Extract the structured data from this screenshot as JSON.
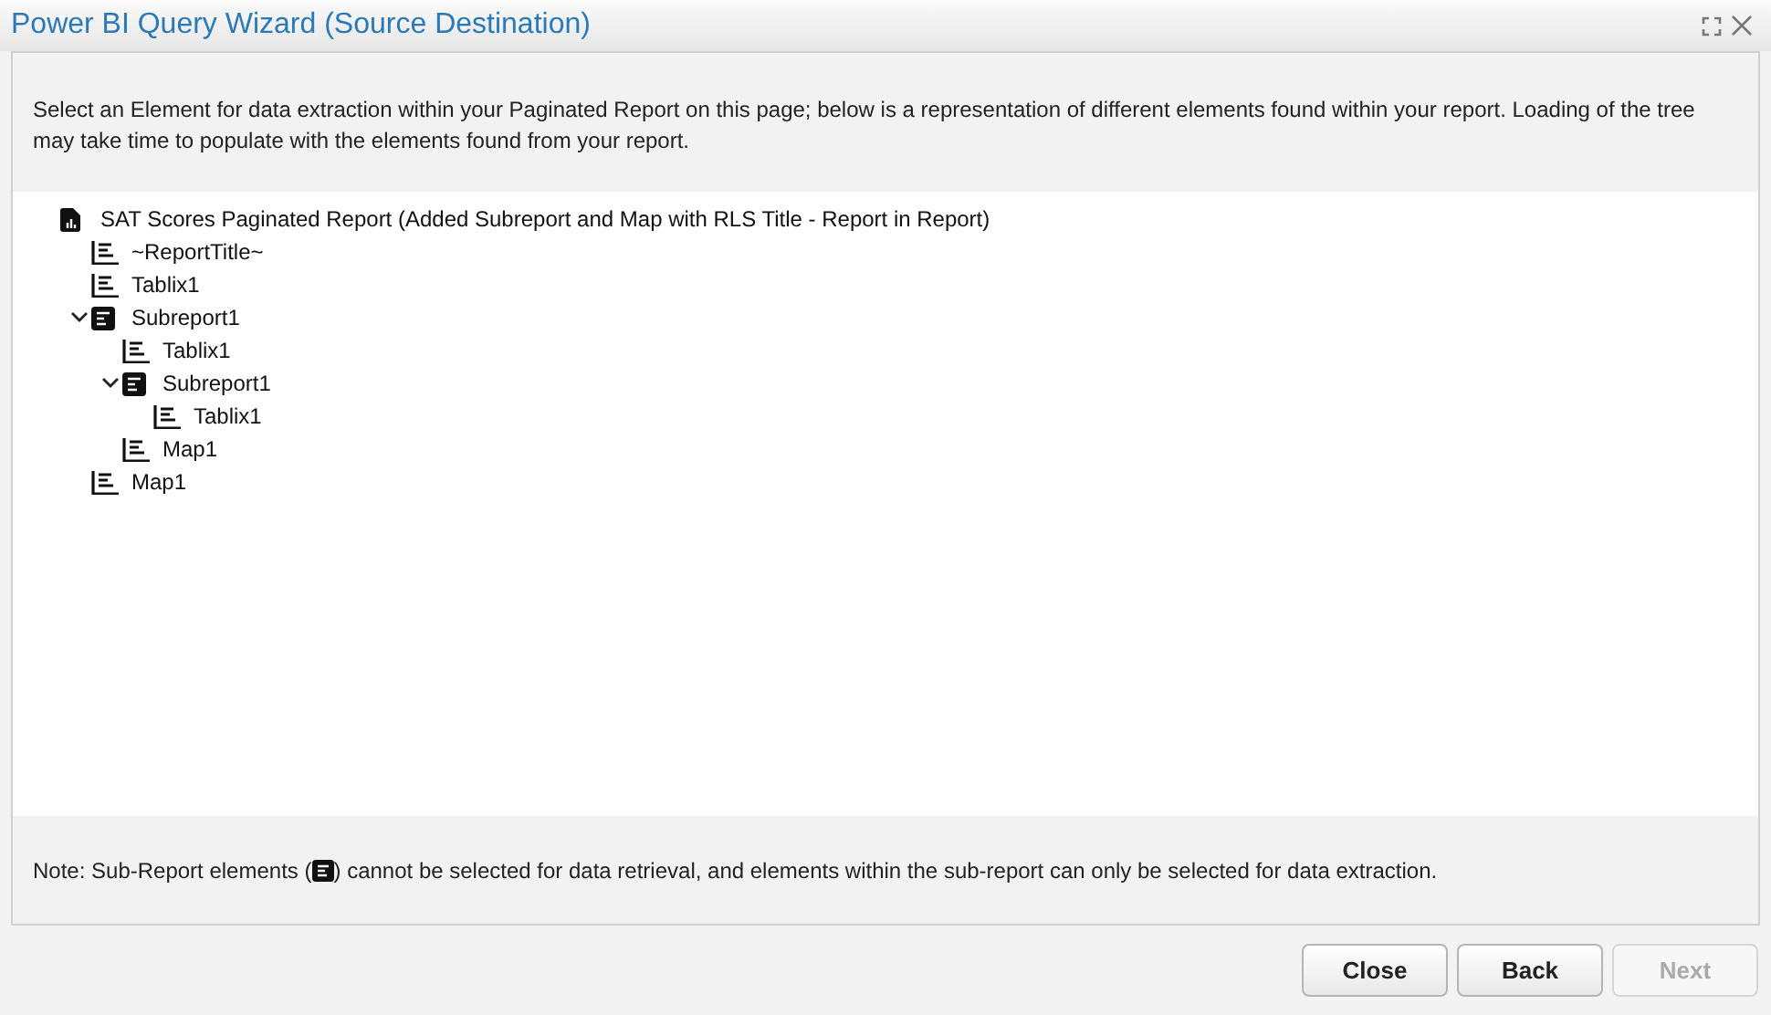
{
  "window": {
    "title": "Power BI Query Wizard (Source Destination)"
  },
  "description": "Select an Element for data extraction within your Paginated Report on this page; below is a representation of different elements found within your report. Loading of the tree may take time to populate with the elements found from your report.",
  "tree": [
    {
      "label": "SAT Scores Paginated Report (Added Subreport and Map with RLS Title - Report in Report)",
      "kind": "report",
      "children": [
        {
          "label": "~ReportTitle~",
          "kind": "table"
        },
        {
          "label": "Tablix1",
          "kind": "table"
        },
        {
          "label": "Subreport1",
          "kind": "subreport",
          "expanded": true,
          "children": [
            {
              "label": "Tablix1",
              "kind": "table"
            },
            {
              "label": "Subreport1",
              "kind": "subreport",
              "expanded": true,
              "children": [
                {
                  "label": "Tablix1",
                  "kind": "table"
                }
              ]
            },
            {
              "label": "Map1",
              "kind": "table"
            }
          ]
        },
        {
          "label": "Map1",
          "kind": "table"
        }
      ]
    }
  ],
  "note": {
    "before": "Note: Sub-Report elements (",
    "after": ") cannot be selected for data retrieval, and elements within the sub-report can only be selected for data extraction."
  },
  "buttons": [
    {
      "label": "Close",
      "disabled": false
    },
    {
      "label": "Back",
      "disabled": false
    },
    {
      "label": "Next",
      "disabled": true
    }
  ]
}
